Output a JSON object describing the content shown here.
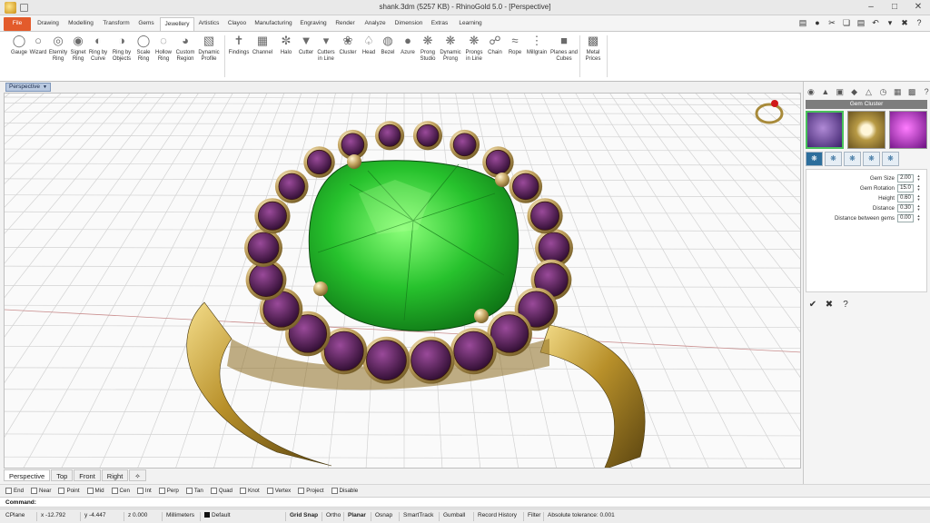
{
  "window": {
    "title": "shank.3dm (5257 KB) - RhinoGold 5.0 - [Perspective]"
  },
  "ribbon_tabs": [
    "File",
    "Drawing",
    "Modelling",
    "Transform",
    "Gems",
    "Jewellery",
    "Artistics",
    "Clayoo",
    "Manufacturing",
    "Engraving",
    "Render",
    "Analyze",
    "Dimension",
    "Extras",
    "Learning"
  ],
  "ribbon_groups": {
    "rings": [
      "Gauge",
      "Wizard",
      "Eternity\nRing",
      "Signet\nRing",
      "Ring by\nCurve",
      "Ring by\nObjects",
      "Scale\nRing",
      "Hollow\nRing",
      "Custom\nRegion",
      "Dynamic\nProfile"
    ],
    "findings": [
      "Findings",
      "Channel",
      "Halo",
      "Cutter",
      "Cutters\nin Line",
      "Cluster",
      "Head",
      "Bezel",
      "Azure",
      "Prong\nStudio",
      "Dynamic\nProng",
      "Prongs\nin Line",
      "Chain",
      "Rope",
      "Millgrain",
      "Planes and\nCubes"
    ],
    "prices": [
      "Metal\nPrices"
    ]
  },
  "viewport": {
    "active_label": "Perspective"
  },
  "gem_cluster_panel": {
    "title": "Gem Cluster",
    "params": [
      {
        "label": "Gem Size",
        "value": "2.00"
      },
      {
        "label": "Gem Rotation",
        "value": "15.0"
      },
      {
        "label": "Height",
        "value": "0.60"
      },
      {
        "label": "Distance",
        "value": "0.30"
      },
      {
        "label": "Distance between gems",
        "value": "0.00"
      }
    ]
  },
  "viewport_tabs": [
    "Perspective",
    "Top",
    "Front",
    "Right",
    "✧"
  ],
  "osnaps": [
    "End",
    "Near",
    "Point",
    "Mid",
    "Cen",
    "Int",
    "Perp",
    "Tan",
    "Quad",
    "Knot",
    "Vertex",
    "Project",
    "Disable"
  ],
  "command": {
    "label": "Command:",
    "value": ""
  },
  "status": {
    "cplane": "CPlane",
    "x": "x -12.792",
    "y": "y -4.447",
    "z": "z 0.000",
    "units": "Millimeters",
    "layer": "Default",
    "grid_snap": "Grid Snap",
    "ortho": "Ortho",
    "planar": "Planar",
    "osnap": "Osnap",
    "smarttrack": "SmartTrack",
    "gumball": "Gumball",
    "record_history": "Record History",
    "filter": "Filter",
    "tolerance": "Absolute tolerance: 0.001"
  },
  "colors": {
    "file_tab": "#e35b2b",
    "viewport_tab": "#b9c9e0",
    "gem_green": "#2fd23a",
    "gem_purple": "#5a1f5a",
    "metal_gold": "#c9a43a"
  }
}
